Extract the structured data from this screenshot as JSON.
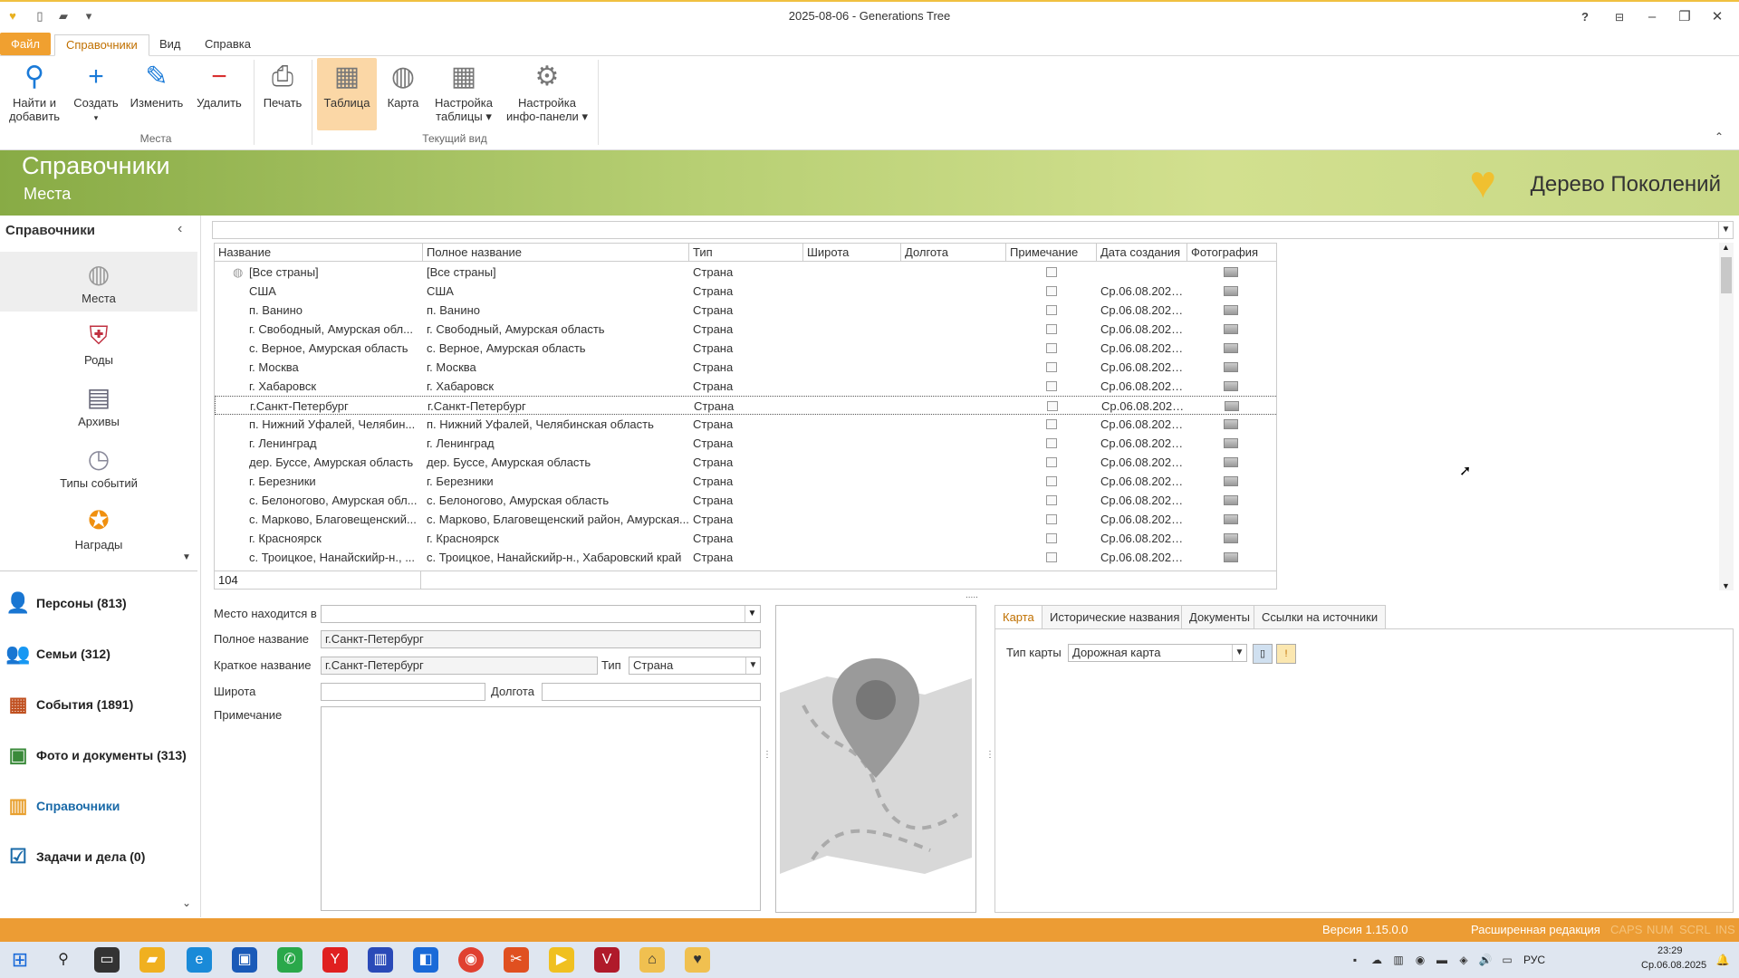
{
  "window": {
    "title": "2025-08-06 - Generations Tree"
  },
  "titlebar": {
    "help": "?",
    "min": "–",
    "restore": "❐",
    "close": "✕"
  },
  "menu": {
    "tabs": [
      "Файл",
      "Справочники",
      "Вид",
      "Справка"
    ]
  },
  "ribbon": {
    "find": "Найти и добавить",
    "create": "Создать",
    "edit": "Изменить",
    "delete": "Удалить",
    "print": "Печать",
    "table": "Таблица",
    "map": "Карта",
    "table_settings": "Настройка таблицы",
    "info_settings": "Настройка инфо-панели",
    "group_places": "Места",
    "group_view": "Текущий вид"
  },
  "banner": {
    "title": "Справочники",
    "subtitle": "Места",
    "brand": "Дерево Поколений"
  },
  "leftnav": {
    "header": "Справочники",
    "items": [
      "Места",
      "Роды",
      "Архивы",
      "Типы событий",
      "Награды"
    ],
    "sections": [
      "Персоны (813)",
      "Семьи (312)",
      "События (1891)",
      "Фото и документы (313)",
      "Справочники",
      "Задачи и дела (0)"
    ]
  },
  "grid": {
    "columns": [
      "Название",
      "Полное название",
      "Тип",
      "Широта",
      "Долгота",
      "Примечание",
      "Дата создания",
      "Фотография"
    ],
    "rows": [
      {
        "name": "[Все страны]",
        "full": "[Все страны]",
        "type": "Страна",
        "date": ""
      },
      {
        "name": "США",
        "full": "США",
        "type": "Страна",
        "date": "Ср.06.08.2025..."
      },
      {
        "name": "п. Ванино",
        "full": "п. Ванино",
        "type": "Страна",
        "date": "Ср.06.08.2025..."
      },
      {
        "name": "г. Свободный, Амурская обл...",
        "full": "г. Свободный, Амурская область",
        "type": "Страна",
        "date": "Ср.06.08.2025..."
      },
      {
        "name": "с. Верное, Амурская область",
        "full": "с. Верное, Амурская область",
        "type": "Страна",
        "date": "Ср.06.08.2025..."
      },
      {
        "name": "г. Москва",
        "full": "г. Москва",
        "type": "Страна",
        "date": "Ср.06.08.2025..."
      },
      {
        "name": "г. Хабаровск",
        "full": "г. Хабаровск",
        "type": "Страна",
        "date": "Ср.06.08.2025..."
      },
      {
        "name": "г.Санкт-Петербург",
        "full": "г.Санкт-Петербург",
        "type": "Страна",
        "date": "Ср.06.08.2025..."
      },
      {
        "name": "п. Нижний Уфалей, Челябин...",
        "full": "п. Нижний Уфалей, Челябинская область",
        "type": "Страна",
        "date": "Ср.06.08.2025..."
      },
      {
        "name": "г. Ленинград",
        "full": "г. Ленинград",
        "type": "Страна",
        "date": "Ср.06.08.2025..."
      },
      {
        "name": "дер. Буссе, Амурская область",
        "full": "дер. Буссе, Амурская область",
        "type": "Страна",
        "date": "Ср.06.08.2025..."
      },
      {
        "name": "г. Березники",
        "full": "г. Березники",
        "type": "Страна",
        "date": "Ср.06.08.2025..."
      },
      {
        "name": "с. Белоногово, Амурская обл...",
        "full": "с. Белоногово, Амурская область",
        "type": "Страна",
        "date": "Ср.06.08.2025..."
      },
      {
        "name": "с. Марково, Благовещенский...",
        "full": "с. Марково, Благовещенский район, Амурская...",
        "type": "Страна",
        "date": "Ср.06.08.2025..."
      },
      {
        "name": "г. Красноярск",
        "full": "г. Красноярск",
        "type": "Страна",
        "date": "Ср.06.08.2025..."
      },
      {
        "name": "с. Троицкое, Нанайскийр-н., ...",
        "full": "с. Троицкое, Нанайскийр-н., Хабаровский край",
        "type": "Страна",
        "date": "Ср.06.08.2025..."
      }
    ],
    "count": "104"
  },
  "form": {
    "located_in_label": "Место находится в",
    "located_in_value": "",
    "full_name_label": "Полное название",
    "full_name_value": "г.Санкт-Петербург",
    "short_name_label": "Краткое название",
    "short_name_value": "г.Санкт-Петербург",
    "type_label": "Тип",
    "type_value": "Страна",
    "lat_label": "Широта",
    "lat_value": "",
    "lon_label": "Долгота",
    "lon_value": "",
    "note_label": "Примечание"
  },
  "tabs2": {
    "tabs": [
      "Карта",
      "Исторические названия",
      "Документы",
      "Ссылки на источники"
    ],
    "map_type_label": "Тип карты",
    "map_type_value": "Дорожная карта"
  },
  "status": {
    "version": "Версия 1.15.0.0",
    "edition": "Расширенная редакция",
    "caps": "CAPS",
    "num": "NUM",
    "scrl": "SCRL",
    "ins": "INS"
  },
  "taskbar": {
    "lang": "РУС",
    "time": "23:29",
    "date": "Ср.06.08.2025"
  }
}
